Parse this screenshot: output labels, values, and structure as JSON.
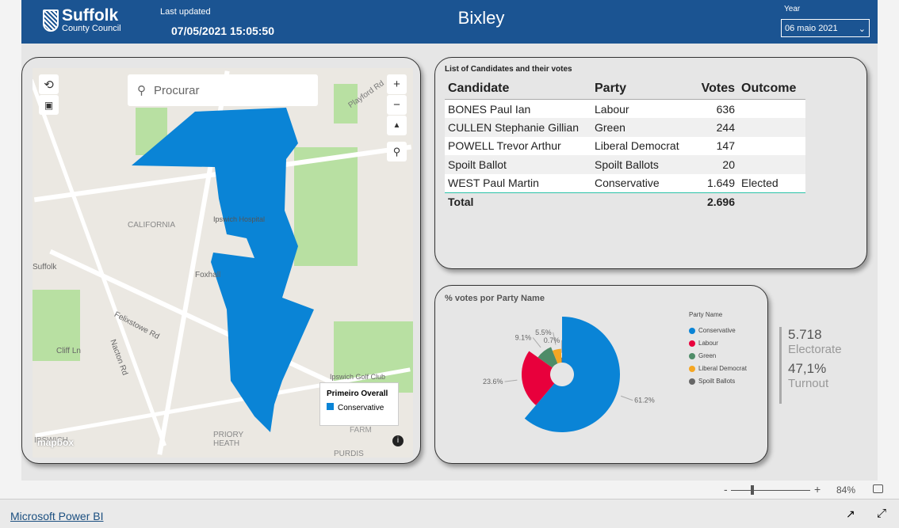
{
  "header": {
    "logo_line1": "Suffolk",
    "logo_line2": "County Council",
    "last_updated_label": "Last updated",
    "timestamp": "07/05/2021 15:05:50",
    "title": "Bixley",
    "year_label": "Year",
    "year_value": "06 maio 2021",
    "color": "#1b5492"
  },
  "map": {
    "search_placeholder": "Procurar",
    "legend_title": "Primeiro Overall",
    "legend_item": "Conservative",
    "labels": [
      "Playford Rd",
      "Ipswich Hospital",
      "CALIFORNIA",
      "Foxhall",
      "Felixstowe Rd",
      "Ipswich Golf Club",
      "PRIORY HEATH",
      "PURDIS",
      "Suffolk",
      "Cliff Ln",
      "Nacton Rd",
      "FARM",
      "IPSWICH"
    ],
    "attribution": "mapbox",
    "fill_color": "#0a84d6"
  },
  "table": {
    "title": "List of Candidates and their votes",
    "columns": [
      "Candidate",
      "Party",
      "Votes",
      "Outcome"
    ],
    "rows": [
      [
        "BONES Paul Ian",
        "Labour",
        "636",
        ""
      ],
      [
        "CULLEN Stephanie Gillian",
        "Green",
        "244",
        ""
      ],
      [
        "POWELL Trevor Arthur",
        "Liberal Democrat",
        "147",
        ""
      ],
      [
        "Spoilt Ballot",
        "Spoilt Ballots",
        "20",
        ""
      ],
      [
        "WEST Paul Martin",
        "Conservative",
        "1.649",
        "Elected"
      ]
    ],
    "total_label": "Total",
    "total_votes": "2.696"
  },
  "chart_data": {
    "type": "pie",
    "title": "% votes por Party Name",
    "legend_title": "Party Name",
    "legend_position": "right",
    "categories": [
      "Conservative",
      "Labour",
      "Green",
      "Liberal Democrat",
      "Spoilt Ballots"
    ],
    "values": [
      61.2,
      23.6,
      9.1,
      5.5,
      0.7
    ],
    "labels": [
      "61.2%",
      "23.6%",
      "9.1%",
      "5.5%",
      "0.7%"
    ],
    "colors": [
      "#0a84d6",
      "#e8003c",
      "#4e8c68",
      "#f5a623",
      "#666666"
    ]
  },
  "kpis": {
    "electorate_value": "5.718",
    "electorate_label": "Electorate",
    "turnout_value": "47,1%",
    "turnout_label": "Turnout"
  },
  "zoom": {
    "minus": "-",
    "plus": "+",
    "level": "84%",
    "value": 84
  },
  "footer": {
    "brand": "Microsoft Power BI"
  }
}
